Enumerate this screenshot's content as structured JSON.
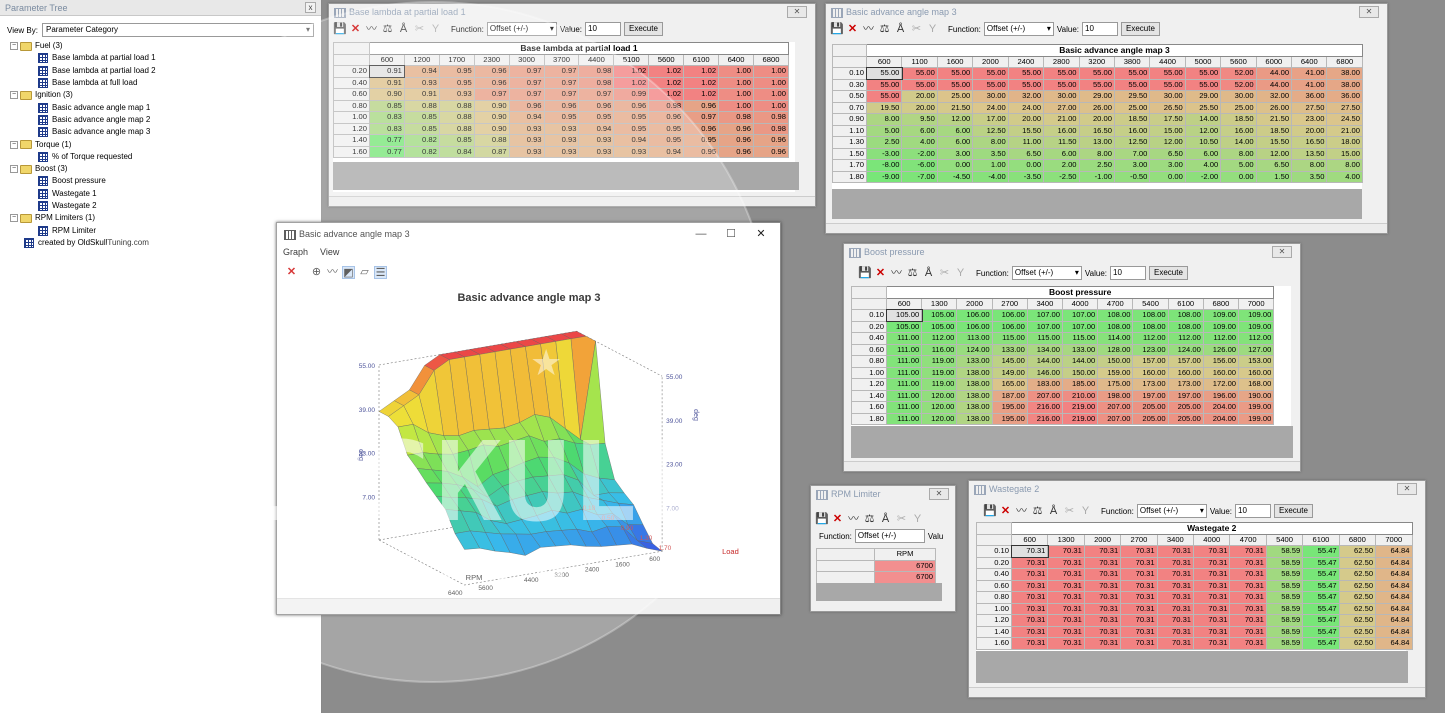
{
  "tree": {
    "title": "Parameter Tree",
    "close": "x",
    "viewby_label": "View By:",
    "viewby_value": "Parameter Category",
    "nodes": [
      {
        "label": "Fuel (3)",
        "level": 0,
        "type": "folder"
      },
      {
        "label": "Base lambda at partial load 1",
        "level": 1,
        "type": "map"
      },
      {
        "label": "Base lambda at partial load 2",
        "level": 1,
        "type": "map"
      },
      {
        "label": "Base lambda at full load",
        "level": 1,
        "type": "map"
      },
      {
        "label": "Ignition (3)",
        "level": 0,
        "type": "folder"
      },
      {
        "label": "Basic advance angle map 1",
        "level": 1,
        "type": "map"
      },
      {
        "label": "Basic advance angle map 2",
        "level": 1,
        "type": "map"
      },
      {
        "label": "Basic advance angle map 3",
        "level": 1,
        "type": "map"
      },
      {
        "label": "Torque (1)",
        "level": 0,
        "type": "folder"
      },
      {
        "label": "% of Torque requested",
        "level": 1,
        "type": "map"
      },
      {
        "label": "Boost (3)",
        "level": 0,
        "type": "folder"
      },
      {
        "label": "Boost pressure",
        "level": 1,
        "type": "map"
      },
      {
        "label": "Wastegate 1",
        "level": 1,
        "type": "map"
      },
      {
        "label": "Wastegate 2",
        "level": 1,
        "type": "map"
      },
      {
        "label": "RPM Limiters (1)",
        "level": 0,
        "type": "folder"
      },
      {
        "label": "RPM Limiter",
        "level": 1,
        "type": "map"
      },
      {
        "label": "created by OldSkullTuning.com",
        "level": 0,
        "type": "map"
      }
    ]
  },
  "toolbar": {
    "function_label": "Function:",
    "function_value": "Offset (+/-)",
    "value_label": "Value:",
    "value": "10",
    "execute": "Execute",
    "value_short": "Valu"
  },
  "lambda": {
    "title": "Base lambda at partial load 1",
    "caption": "Base lambda at partial load 1",
    "cols": [
      "600",
      "1200",
      "1700",
      "2300",
      "3000",
      "3700",
      "4400",
      "5100",
      "5600",
      "6100",
      "6400",
      "6800"
    ],
    "rows": [
      {
        "h": "0.20",
        "v": [
          "0.91",
          "0.94",
          "0.95",
          "0.96",
          "0.97",
          "0.97",
          "0.98",
          "1.02",
          "1.02",
          "1.02",
          "1.00",
          "1.00"
        ]
      },
      {
        "h": "0.40",
        "v": [
          "0.91",
          "0.93",
          "0.95",
          "0.96",
          "0.97",
          "0.97",
          "0.98",
          "1.02",
          "1.02",
          "1.02",
          "1.00",
          "1.00"
        ]
      },
      {
        "h": "0.60",
        "v": [
          "0.90",
          "0.91",
          "0.93",
          "0.97",
          "0.97",
          "0.97",
          "0.97",
          "0.99",
          "1.02",
          "1.02",
          "1.00",
          "1.00"
        ]
      },
      {
        "h": "0.80",
        "v": [
          "0.85",
          "0.88",
          "0.88",
          "0.90",
          "0.96",
          "0.96",
          "0.96",
          "0.96",
          "0.98",
          "0.96",
          "1.00",
          "1.00"
        ]
      },
      {
        "h": "1.00",
        "v": [
          "0.83",
          "0.85",
          "0.88",
          "0.90",
          "0.94",
          "0.95",
          "0.95",
          "0.95",
          "0.96",
          "0.97",
          "0.98",
          "0.98"
        ]
      },
      {
        "h": "1.20",
        "v": [
          "0.83",
          "0.85",
          "0.88",
          "0.90",
          "0.93",
          "0.93",
          "0.94",
          "0.95",
          "0.95",
          "0.96",
          "0.96",
          "0.98"
        ]
      },
      {
        "h": "1.40",
        "v": [
          "0.77",
          "0.82",
          "0.85",
          "0.88",
          "0.93",
          "0.93",
          "0.93",
          "0.94",
          "0.95",
          "0.95",
          "0.96",
          "0.96"
        ]
      },
      {
        "h": "1.60",
        "v": [
          "0.77",
          "0.82",
          "0.84",
          "0.87",
          "0.93",
          "0.93",
          "0.93",
          "0.93",
          "0.94",
          "0.95",
          "0.96",
          "0.96"
        ]
      }
    ]
  },
  "advance": {
    "title": "Basic advance angle map 3",
    "caption": "Basic advance angle map 3",
    "cols": [
      "600",
      "1100",
      "1600",
      "2000",
      "2400",
      "2800",
      "3200",
      "3800",
      "4400",
      "5000",
      "5600",
      "6000",
      "6400",
      "6800"
    ],
    "rows": [
      {
        "h": "0.10",
        "v": [
          "55.00",
          "55.00",
          "55.00",
          "55.00",
          "55.00",
          "55.00",
          "55.00",
          "55.00",
          "55.00",
          "55.00",
          "52.00",
          "44.00",
          "41.00",
          "38.00"
        ]
      },
      {
        "h": "0.30",
        "v": [
          "55.00",
          "55.00",
          "55.00",
          "55.00",
          "55.00",
          "55.00",
          "55.00",
          "55.00",
          "55.00",
          "55.00",
          "52.00",
          "44.00",
          "41.00",
          "38.00"
        ]
      },
      {
        "h": "0.50",
        "v": [
          "55.00",
          "20.00",
          "25.00",
          "30.00",
          "32.00",
          "30.00",
          "29.00",
          "29.50",
          "30.00",
          "29.00",
          "30.00",
          "32.00",
          "36.00",
          "36.00"
        ]
      },
      {
        "h": "0.70",
        "v": [
          "19.50",
          "20.00",
          "21.50",
          "24.00",
          "24.00",
          "27.00",
          "26.00",
          "25.00",
          "26.50",
          "25.50",
          "25.00",
          "26.00",
          "27.50",
          "27.50"
        ]
      },
      {
        "h": "0.90",
        "v": [
          "8.00",
          "9.50",
          "12.00",
          "17.00",
          "20.00",
          "21.00",
          "20.00",
          "18.50",
          "17.50",
          "14.00",
          "18.50",
          "21.50",
          "23.00",
          "24.50"
        ]
      },
      {
        "h": "1.10",
        "v": [
          "5.00",
          "6.00",
          "6.00",
          "12.50",
          "15.50",
          "16.00",
          "16.50",
          "16.00",
          "15.00",
          "12.00",
          "16.00",
          "18.50",
          "20.00",
          "21.00"
        ]
      },
      {
        "h": "1.30",
        "v": [
          "2.50",
          "4.00",
          "6.00",
          "8.00",
          "11.00",
          "11.50",
          "13.00",
          "12.50",
          "12.00",
          "10.50",
          "14.00",
          "15.50",
          "16.50",
          "18.00"
        ]
      },
      {
        "h": "1.50",
        "v": [
          "-3.00",
          "-2.00",
          "3.00",
          "3.50",
          "6.50",
          "6.00",
          "8.00",
          "7.00",
          "6.50",
          "6.00",
          "8.00",
          "12.00",
          "13.50",
          "15.00"
        ]
      },
      {
        "h": "1.70",
        "v": [
          "-8.00",
          "-6.00",
          "0.00",
          "1.00",
          "0.00",
          "2.00",
          "2.50",
          "3.00",
          "3.00",
          "4.00",
          "5.00",
          "6.50",
          "8.00",
          "8.00"
        ]
      },
      {
        "h": "1.80",
        "v": [
          "-9.00",
          "-7.00",
          "-4.50",
          "-4.00",
          "-3.50",
          "-2.50",
          "-1.00",
          "-0.50",
          "0.00",
          "-2.00",
          "0.00",
          "1.50",
          "3.50",
          "4.00"
        ]
      }
    ]
  },
  "boost": {
    "title": "Boost pressure",
    "caption": "Boost pressure",
    "cols": [
      "600",
      "1300",
      "2000",
      "2700",
      "3400",
      "4000",
      "4700",
      "5400",
      "6100",
      "6800",
      "7000"
    ],
    "rows": [
      {
        "h": "0.10",
        "v": [
          "105.00",
          "105.00",
          "106.00",
          "106.00",
          "107.00",
          "107.00",
          "108.00",
          "108.00",
          "108.00",
          "109.00",
          "109.00"
        ]
      },
      {
        "h": "0.20",
        "v": [
          "105.00",
          "105.00",
          "106.00",
          "106.00",
          "107.00",
          "107.00",
          "108.00",
          "108.00",
          "108.00",
          "109.00",
          "109.00"
        ]
      },
      {
        "h": "0.40",
        "v": [
          "111.00",
          "112.00",
          "113.00",
          "115.00",
          "115.00",
          "115.00",
          "114.00",
          "112.00",
          "112.00",
          "112.00",
          "112.00"
        ]
      },
      {
        "h": "0.60",
        "v": [
          "111.00",
          "116.00",
          "124.00",
          "133.00",
          "134.00",
          "133.00",
          "128.00",
          "123.00",
          "124.00",
          "126.00",
          "127.00"
        ]
      },
      {
        "h": "0.80",
        "v": [
          "111.00",
          "119.00",
          "133.00",
          "145.00",
          "144.00",
          "144.00",
          "150.00",
          "157.00",
          "157.00",
          "156.00",
          "153.00"
        ]
      },
      {
        "h": "1.00",
        "v": [
          "111.00",
          "119.00",
          "138.00",
          "149.00",
          "146.00",
          "150.00",
          "159.00",
          "160.00",
          "160.00",
          "160.00",
          "160.00"
        ]
      },
      {
        "h": "1.20",
        "v": [
          "111.00",
          "119.00",
          "138.00",
          "165.00",
          "183.00",
          "185.00",
          "175.00",
          "173.00",
          "173.00",
          "172.00",
          "168.00"
        ]
      },
      {
        "h": "1.40",
        "v": [
          "111.00",
          "120.00",
          "138.00",
          "187.00",
          "207.00",
          "210.00",
          "198.00",
          "197.00",
          "197.00",
          "196.00",
          "190.00"
        ]
      },
      {
        "h": "1.60",
        "v": [
          "111.00",
          "120.00",
          "138.00",
          "195.00",
          "216.00",
          "219.00",
          "207.00",
          "205.00",
          "205.00",
          "204.00",
          "199.00"
        ]
      },
      {
        "h": "1.80",
        "v": [
          "111.00",
          "120.00",
          "138.00",
          "195.00",
          "216.00",
          "219.00",
          "207.00",
          "205.00",
          "205.00",
          "204.00",
          "199.00"
        ]
      }
    ]
  },
  "rpm": {
    "title": "RPM Limiter",
    "col": "RPM",
    "values": [
      "6700",
      "6700"
    ]
  },
  "wastegate": {
    "title": "Wastegate 2",
    "caption": "Wastegate 2",
    "cols": [
      "600",
      "1300",
      "2000",
      "2700",
      "3400",
      "4000",
      "4700",
      "5400",
      "6100",
      "6800",
      "7000"
    ],
    "rows": [
      {
        "h": "0.10",
        "v": [
          "70.31",
          "70.31",
          "70.31",
          "70.31",
          "70.31",
          "70.31",
          "70.31",
          "58.59",
          "55.47",
          "62.50",
          "64.84"
        ]
      },
      {
        "h": "0.20",
        "v": [
          "70.31",
          "70.31",
          "70.31",
          "70.31",
          "70.31",
          "70.31",
          "70.31",
          "58.59",
          "55.47",
          "62.50",
          "64.84"
        ]
      },
      {
        "h": "0.40",
        "v": [
          "70.31",
          "70.31",
          "70.31",
          "70.31",
          "70.31",
          "70.31",
          "70.31",
          "58.59",
          "55.47",
          "62.50",
          "64.84"
        ]
      },
      {
        "h": "0.60",
        "v": [
          "70.31",
          "70.31",
          "70.31",
          "70.31",
          "70.31",
          "70.31",
          "70.31",
          "58.59",
          "55.47",
          "62.50",
          "64.84"
        ]
      },
      {
        "h": "0.80",
        "v": [
          "70.31",
          "70.31",
          "70.31",
          "70.31",
          "70.31",
          "70.31",
          "70.31",
          "58.59",
          "55.47",
          "62.50",
          "64.84"
        ]
      },
      {
        "h": "1.00",
        "v": [
          "70.31",
          "70.31",
          "70.31",
          "70.31",
          "70.31",
          "70.31",
          "70.31",
          "58.59",
          "55.47",
          "62.50",
          "64.84"
        ]
      },
      {
        "h": "1.20",
        "v": [
          "70.31",
          "70.31",
          "70.31",
          "70.31",
          "70.31",
          "70.31",
          "70.31",
          "58.59",
          "55.47",
          "62.50",
          "64.84"
        ]
      },
      {
        "h": "1.40",
        "v": [
          "70.31",
          "70.31",
          "70.31",
          "70.31",
          "70.31",
          "70.31",
          "70.31",
          "58.59",
          "55.47",
          "62.50",
          "64.84"
        ]
      },
      {
        "h": "1.60",
        "v": [
          "70.31",
          "70.31",
          "70.31",
          "70.31",
          "70.31",
          "70.31",
          "70.31",
          "58.59",
          "55.47",
          "62.50",
          "64.84"
        ]
      }
    ]
  },
  "graph": {
    "title": "Basic advance angle map 3",
    "menu": [
      "Graph",
      "View"
    ],
    "plot_title": "Basic advance angle map 3",
    "z_ticks": [
      "55.00",
      "39.00",
      "23.00",
      "7.00"
    ],
    "z_ticks_right": [
      "55.00",
      "39.00",
      "23.00",
      "7.00"
    ],
    "z_label": "deg",
    "rpm_ticks": [
      "6400",
      "5600",
      "4400",
      "3200",
      "2400",
      "1600",
      "600"
    ],
    "load_ticks": [
      "0.10",
      "0.50",
      "0.90",
      "1.30",
      "1.70"
    ],
    "rpm_label": "RPM",
    "load_label": "Load"
  },
  "watermark": {
    "line1": "OLDSKULL",
    "line2": "TUNING"
  }
}
